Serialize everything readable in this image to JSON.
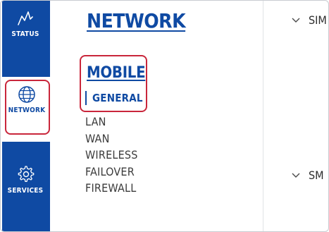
{
  "nav": {
    "items": [
      {
        "key": "status",
        "label": "STATUS",
        "icon": "status-icon"
      },
      {
        "key": "network",
        "label": "NETWORK",
        "icon": "globe-icon",
        "active": true
      },
      {
        "key": "services",
        "label": "SERVICES",
        "icon": "gear-icon"
      }
    ]
  },
  "submenu": {
    "title": "NETWORK",
    "group": "MOBILE",
    "group_child": "GENERAL",
    "items": [
      "LAN",
      "WAN",
      "WIRELESS",
      "FAILOVER",
      "FIREWALL"
    ]
  },
  "content": {
    "sections": [
      {
        "label": "SIM",
        "icon": "chevron-down-icon"
      },
      {
        "label": "SM",
        "icon": "chevron-down-icon"
      }
    ]
  },
  "colors": {
    "rail": "#0f4aa3",
    "accent": "#0f4aa3",
    "highlight": "#c9263b"
  }
}
